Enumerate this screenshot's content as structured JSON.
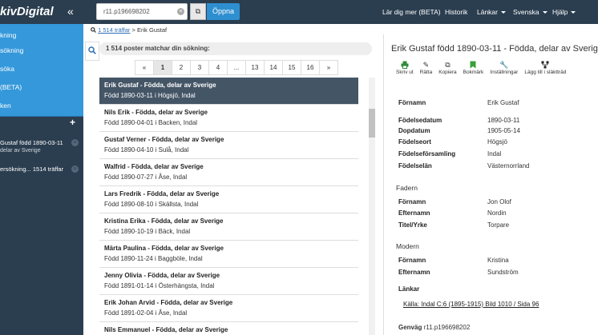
{
  "header": {
    "brand": "kivDigital",
    "collapse_icon": "double-chevron-left",
    "search_value": "r11.p196698202",
    "open_label": "Öppna",
    "nav": [
      {
        "label": "Lär dig mer (BETA)"
      },
      {
        "label": "Historik"
      },
      {
        "label": "Länkar"
      },
      {
        "label": "Svenska"
      },
      {
        "label": "Hjälp"
      }
    ]
  },
  "sidebar": {
    "items": [
      "kning",
      "sökning",
      "söka",
      "(BETA)",
      "ken"
    ],
    "history": [
      {
        "title": "Gustaf född 1890-03-11",
        "sub": "delar av Sverige"
      },
      {
        "title": "ersökning... 1514 träffar",
        "sub": ""
      }
    ]
  },
  "breadcrumb": {
    "count_link": "1 514 träffar",
    "separator": ">",
    "current": "Erik Gustaf"
  },
  "results_header": "1 514 poster matchar din sökning:",
  "pagination": [
    "«",
    "1",
    "2",
    "3",
    "4",
    "...",
    "13",
    "14",
    "15",
    "16",
    "»"
  ],
  "results": [
    {
      "title": "Erik Gustaf - Födda, delar av Sverige",
      "sub": "Född 1890-03-11 i Högsjö, Indal"
    },
    {
      "title": "Nils Erik - Födda, delar av Sverige",
      "sub": "Född 1890-04-01 i Backen, Indal"
    },
    {
      "title": "Gustaf Verner - Födda, delar av Sverige",
      "sub": "Född 1890-04-10 i Sulå, Indal"
    },
    {
      "title": "Walfrid - Födda, delar av Sverige",
      "sub": "Född 1890-07-27 i Åse, Indal"
    },
    {
      "title": "Lars Fredrik - Födda, delar av Sverige",
      "sub": "Född 1890-08-10 i Skällsta, Indal"
    },
    {
      "title": "Kristina Erika - Födda, delar av Sverige",
      "sub": "Född 1890-10-19 i Bäck, Indal"
    },
    {
      "title": "Märta Paulina - Födda, delar av Sverige",
      "sub": "Född 1890-11-24 i Baggböle, Indal"
    },
    {
      "title": "Jenny Olivia - Födda, delar av Sverige",
      "sub": "Född 1891-01-14 i Österhängsta, Indal"
    },
    {
      "title": "Erik Johan Arvid - Födda, delar av Sverige",
      "sub": "Född 1891-02-04 i Åse, Indal"
    },
    {
      "title": "Nils Emmanuel - Födda, delar av Sverige",
      "sub": ""
    }
  ],
  "detail": {
    "title": "Erik Gustaf född 1890-03-11 - Födda, delar av Sverige",
    "tools": [
      {
        "label": "Skriv ut",
        "icon": "print-icon",
        "color": "#2e8b3a"
      },
      {
        "label": "Rätta",
        "icon": "pencil-icon",
        "color": "#222222"
      },
      {
        "label": "Kopiera",
        "icon": "copy-icon",
        "color": "#222222"
      },
      {
        "label": "Bokmärk",
        "icon": "bookmark-icon",
        "color": "#3aa03a"
      },
      {
        "label": "Inställningar",
        "icon": "wrench-icon",
        "color": "#222222"
      },
      {
        "label": "Lägg till i släktträd",
        "icon": "tree-icon",
        "color": "#222222"
      }
    ],
    "person": [
      {
        "k": "Förnamn",
        "v": "Erik Gustaf"
      },
      {
        "k": "Födelsedatum",
        "v": "1890-03-11"
      },
      {
        "k": "Dopdatum",
        "v": "1905-05-14"
      },
      {
        "k": "Födelseort",
        "v": "Högsjö"
      },
      {
        "k": "Födelseförsamling",
        "v": "Indal"
      },
      {
        "k": "Födelselän",
        "v": "Västernorrland"
      }
    ],
    "father_heading": "Fadern",
    "father": [
      {
        "k": "Förnamn",
        "v": "Jon Olof"
      },
      {
        "k": "Efternamn",
        "v": "Nordin"
      },
      {
        "k": "Titel/Yrke",
        "v": "Torpare"
      }
    ],
    "mother_heading": "Modern",
    "mother": [
      {
        "k": "Förnamn",
        "v": "Kristina"
      },
      {
        "k": "Efternamn",
        "v": "Sundström"
      }
    ],
    "links_label": "Länkar",
    "source_link": "Källa: Indal C:6 (1895-1915) Bild 1010 / Sida 96",
    "shortcut_label": "Genväg",
    "shortcut_value": "r11.p196698202"
  }
}
